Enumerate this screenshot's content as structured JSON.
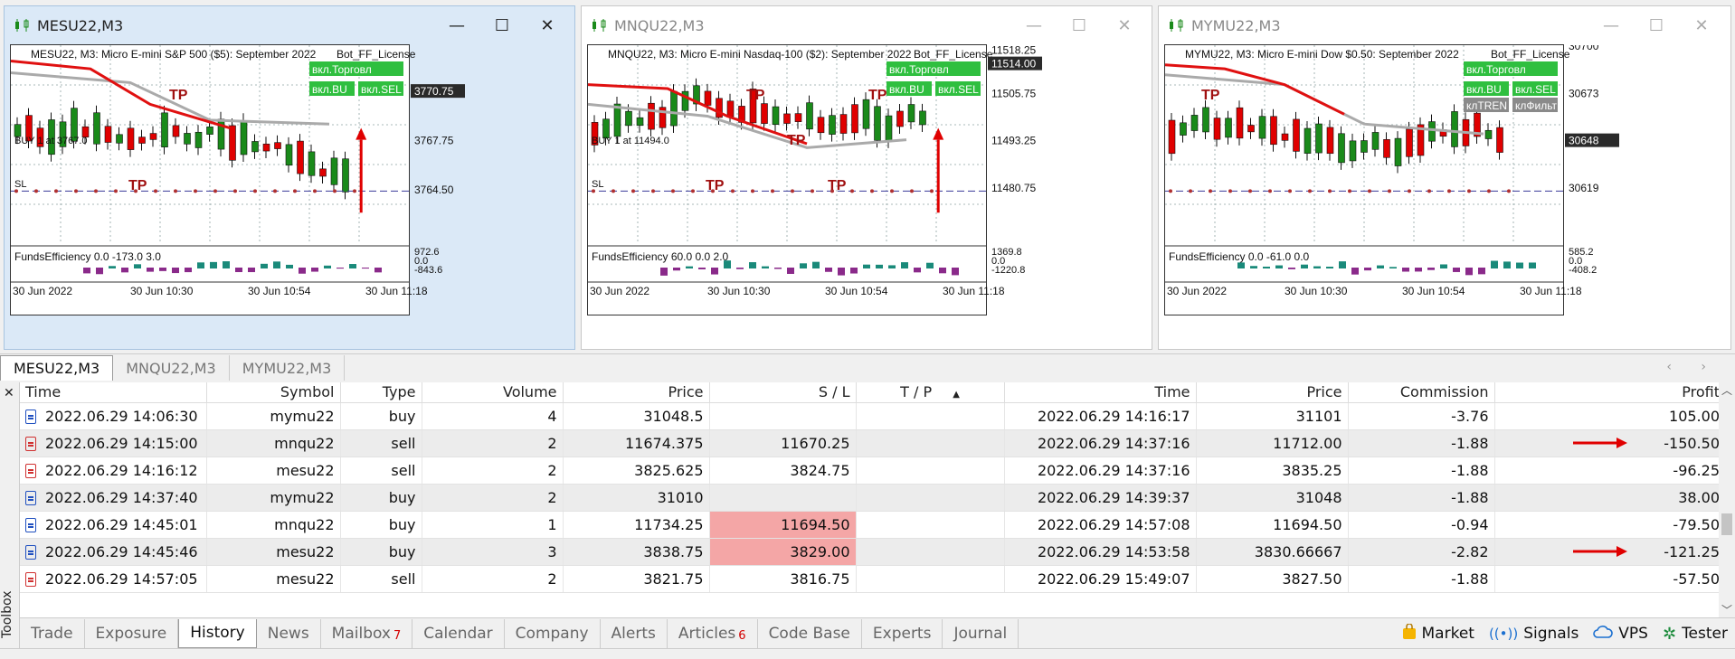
{
  "charts": [
    {
      "title": "MESU22,M3",
      "header": "MESU22, M3:  Micro E-mini S&P 500 ($5): September 2022",
      "ea": "Bot_FF_License",
      "prices": [
        "3770.75",
        "3767.75",
        "3764.50"
      ],
      "current_price": "3770.75",
      "buttons": [
        "вкл.Торговл",
        "вкл.BU",
        "вкл.SEL"
      ],
      "labels": [
        "BUY 1 at 3767.0",
        "SL",
        "TP",
        "TP"
      ],
      "indicator": "FundsEfficiency 0.0 -173.0 3.0",
      "ind_scale": [
        "972.6",
        "0.0",
        "-843.6"
      ],
      "times": [
        "30 Jun 2022",
        "30 Jun 10:30",
        "30 Jun 10:54",
        "30 Jun 11:18"
      ]
    },
    {
      "title": "MNQU22,M3",
      "header": "MNQU22, M3:  Micro E-mini Nasdaq-100 ($2): September 2022",
      "ea": "Bot_FF_License",
      "prices": [
        "11518.25",
        "11514.00",
        "11505.75",
        "11493.25",
        "11480.75"
      ],
      "current_price": "11514.00",
      "buttons": [
        "вкл.Торговл",
        "вкл.BU",
        "вкл.SEL"
      ],
      "labels": [
        "BUY 1 at 11494.0",
        "SL",
        "TP",
        "TP",
        "TP",
        "TP",
        "TP"
      ],
      "indicator": "FundsEfficiency 60.0 0.0 2.0",
      "ind_scale": [
        "1369.8",
        "0.0",
        "-1220.8"
      ],
      "times": [
        "30 Jun 2022",
        "30 Jun 10:30",
        "30 Jun 10:54",
        "30 Jun 11:18"
      ]
    },
    {
      "title": "MYMU22,M3",
      "header": "MYMU22, M3:  Micro E-mini Dow $0.50: September 2022",
      "ea": "Bot_FF_License",
      "prices": [
        "30700",
        "30673",
        "30648",
        "30619"
      ],
      "current_price": "30648",
      "buttons": [
        "вкл.Торговл",
        "вкл.BU",
        "вкл.SEL",
        "клTREN",
        "клФильт"
      ],
      "labels": [
        "TP"
      ],
      "indicator": "FundsEfficiency 0.0 -61.0 0.0",
      "ind_scale": [
        "585.2",
        "0.0",
        "-408.2"
      ],
      "times": [
        "30 Jun 2022",
        "30 Jun 10:30",
        "30 Jun 10:54",
        "30 Jun 11:18"
      ]
    }
  ],
  "chart_tabs": [
    "MESU22,M3",
    "MNQU22,M3",
    "MYMU22,M3"
  ],
  "history": {
    "columns": [
      "Time",
      "Symbol",
      "Type",
      "Volume",
      "Price",
      "S / L",
      "T / P",
      "Time",
      "Price",
      "Commission",
      "Profit"
    ],
    "rows": [
      {
        "time": "2022.06.29 14:06:30",
        "symbol": "mymu22",
        "type": "buy",
        "volume": "4",
        "price": "31048.5",
        "sl": "",
        "tp": "",
        "time2": "2022.06.29 14:16:17",
        "price2": "31101",
        "commission": "-3.76",
        "profit": "105.00"
      },
      {
        "time": "2022.06.29 14:15:00",
        "symbol": "mnqu22",
        "type": "sell",
        "volume": "2",
        "price": "11674.375",
        "sl": "11670.25",
        "tp": "",
        "time2": "2022.06.29 14:37:16",
        "price2": "11712.00",
        "commission": "-1.88",
        "profit": "-150.50"
      },
      {
        "time": "2022.06.29 14:16:12",
        "symbol": "mesu22",
        "type": "sell",
        "volume": "2",
        "price": "3825.625",
        "sl": "3824.75",
        "tp": "",
        "time2": "2022.06.29 14:37:16",
        "price2": "3835.25",
        "commission": "-1.88",
        "profit": "-96.25"
      },
      {
        "time": "2022.06.29 14:37:40",
        "symbol": "mymu22",
        "type": "buy",
        "volume": "2",
        "price": "31010",
        "sl": "",
        "tp": "",
        "time2": "2022.06.29 14:39:37",
        "price2": "31048",
        "commission": "-1.88",
        "profit": "38.00"
      },
      {
        "time": "2022.06.29 14:45:01",
        "symbol": "mnqu22",
        "type": "buy",
        "volume": "1",
        "price": "11734.25",
        "sl": "11694.50",
        "tp": "",
        "time2": "2022.06.29 14:57:08",
        "price2": "11694.50",
        "commission": "-0.94",
        "profit": "-79.50"
      },
      {
        "time": "2022.06.29 14:45:46",
        "symbol": "mesu22",
        "type": "buy",
        "volume": "3",
        "price": "3838.75",
        "sl": "3829.00",
        "tp": "",
        "time2": "2022.06.29 14:53:58",
        "price2": "3830.66667",
        "commission": "-2.82",
        "profit": "-121.25"
      },
      {
        "time": "2022.06.29 14:57:05",
        "symbol": "mesu22",
        "type": "sell",
        "volume": "2",
        "price": "3821.75",
        "sl": "3816.75",
        "tp": "",
        "time2": "2022.06.29 15:49:07",
        "price2": "3827.50",
        "commission": "-1.88",
        "profit": "-57.50"
      }
    ]
  },
  "toolbox_label": "Toolbox",
  "bottom_tabs": [
    {
      "label": "Trade",
      "count": ""
    },
    {
      "label": "Exposure",
      "count": ""
    },
    {
      "label": "History",
      "count": ""
    },
    {
      "label": "News",
      "count": ""
    },
    {
      "label": "Mailbox",
      "count": "7"
    },
    {
      "label": "Calendar",
      "count": ""
    },
    {
      "label": "Company",
      "count": ""
    },
    {
      "label": "Alerts",
      "count": ""
    },
    {
      "label": "Articles",
      "count": "6"
    },
    {
      "label": "Code Base",
      "count": ""
    },
    {
      "label": "Experts",
      "count": ""
    },
    {
      "label": "Journal",
      "count": ""
    }
  ],
  "right_links": [
    "Market",
    "Signals",
    "VPS",
    "Tester"
  ],
  "colors": {
    "bull": "#1a8a1a",
    "bear": "#e00000",
    "ma_red": "#e01010",
    "ma_grey": "#aaaaaa",
    "loss": "#d40000",
    "gain": "#1d2fd0",
    "sl_highlight": "#f4a6a6",
    "ea_button": "#2fbf3f"
  }
}
